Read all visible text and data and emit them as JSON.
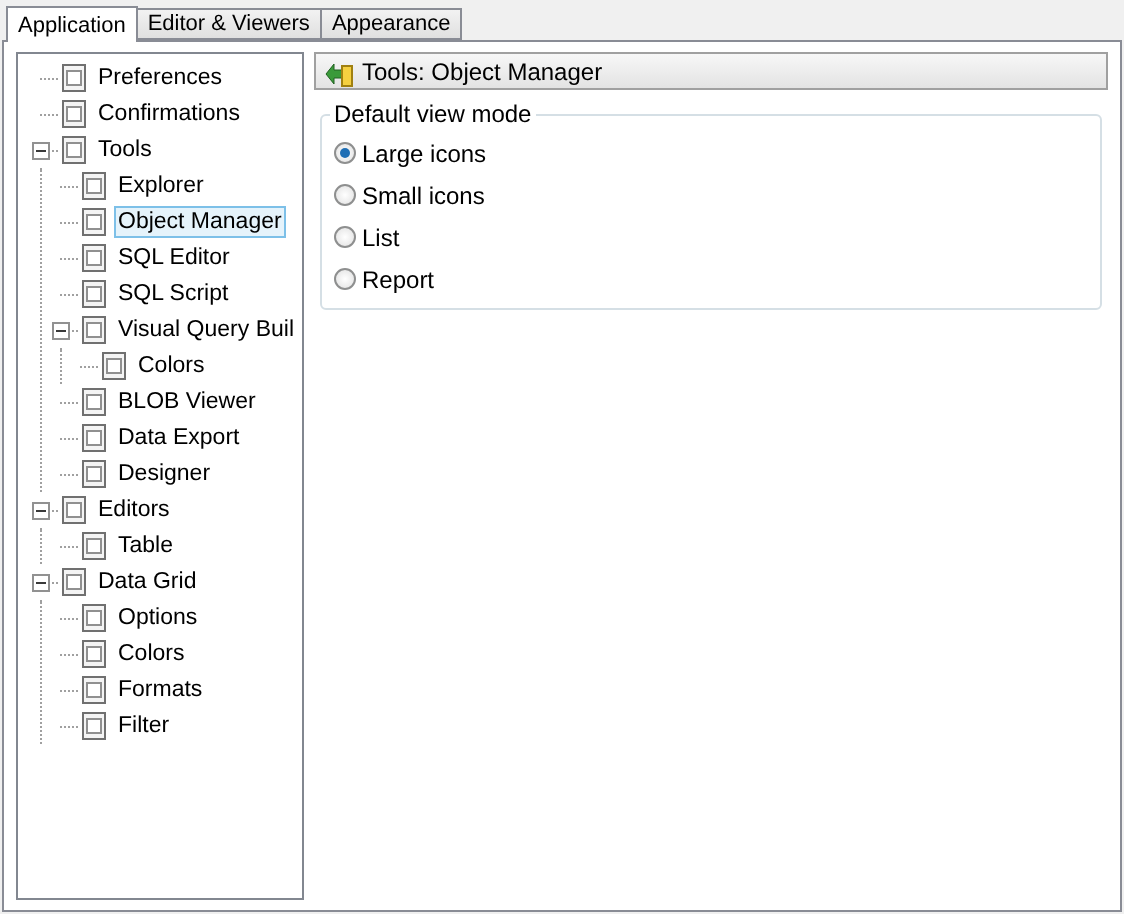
{
  "tabs": [
    {
      "label": "Application",
      "selected": true
    },
    {
      "label": "Editor & Viewers",
      "selected": false
    },
    {
      "label": "Appearance",
      "selected": false
    }
  ],
  "tree": [
    {
      "label": "Preferences",
      "selected": false
    },
    {
      "label": "Confirmations",
      "selected": false
    },
    {
      "label": "Tools",
      "selected": false,
      "expanded": true,
      "children": [
        {
          "label": "Explorer",
          "selected": false
        },
        {
          "label": "Object Manager",
          "selected": true
        },
        {
          "label": "SQL Editor",
          "selected": false
        },
        {
          "label": "SQL Script",
          "selected": false
        },
        {
          "label": "Visual Query Buil",
          "selected": false,
          "expanded": true,
          "children": [
            {
              "label": "Colors",
              "selected": false
            }
          ]
        },
        {
          "label": "BLOB Viewer",
          "selected": false
        },
        {
          "label": "Data Export",
          "selected": false
        },
        {
          "label": "Designer",
          "selected": false
        }
      ]
    },
    {
      "label": "Editors",
      "selected": false,
      "expanded": true,
      "children": [
        {
          "label": "Table",
          "selected": false
        }
      ]
    },
    {
      "label": "Data Grid",
      "selected": false,
      "expanded": true,
      "children": [
        {
          "label": "Options",
          "selected": false
        },
        {
          "label": "Colors",
          "selected": false
        },
        {
          "label": "Formats",
          "selected": false
        },
        {
          "label": "Filter",
          "selected": false
        }
      ]
    }
  ],
  "panel": {
    "title": "Tools: Object Manager",
    "group": {
      "legend": "Default view mode",
      "options": [
        {
          "label": "Large icons",
          "selected": true
        },
        {
          "label": "Small icons",
          "selected": false
        },
        {
          "label": "List",
          "selected": false
        },
        {
          "label": "Report",
          "selected": false
        }
      ]
    }
  }
}
